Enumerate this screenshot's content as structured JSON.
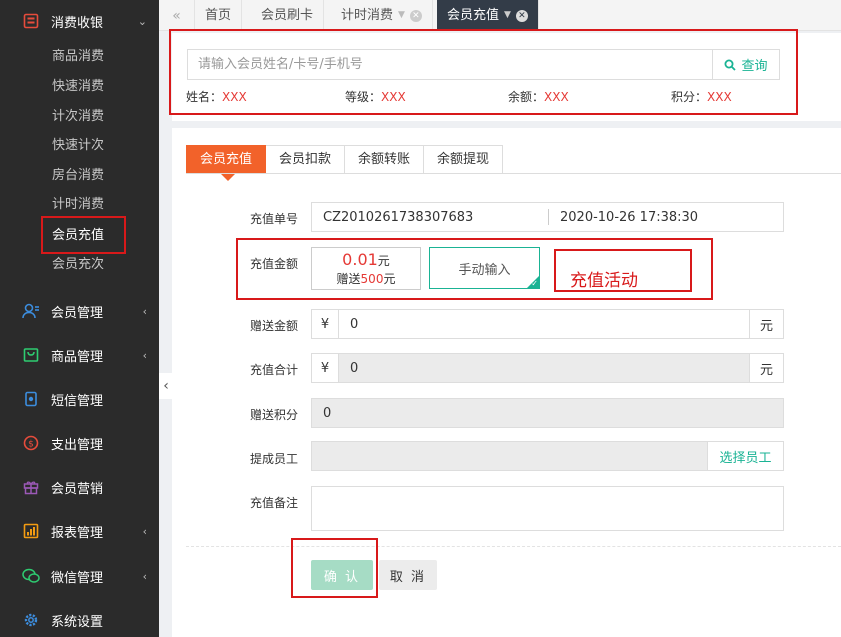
{
  "sidebar": {
    "groups": [
      {
        "label": "消费收银",
        "icon": "cashier-icon",
        "expanded": true
      },
      {
        "label": "会员管理",
        "icon": "member-icon"
      },
      {
        "label": "商品管理",
        "icon": "goods-icon"
      },
      {
        "label": "短信管理",
        "icon": "sms-icon"
      },
      {
        "label": "支出管理",
        "icon": "expense-icon"
      },
      {
        "label": "会员营销",
        "icon": "gift-icon"
      },
      {
        "label": "报表管理",
        "icon": "report-icon"
      },
      {
        "label": "微信管理",
        "icon": "wechat-icon"
      },
      {
        "label": "系统设置",
        "icon": "gear-icon"
      }
    ],
    "sub_items": [
      "商品消费",
      "快速消费",
      "计次消费",
      "快速计次",
      "房台消费",
      "计时消费",
      "会员充值",
      "会员充次"
    ],
    "active_sub": "会员充值"
  },
  "tabs": [
    {
      "label": "首页"
    },
    {
      "label": "会员刷卡"
    },
    {
      "label": "计时消费"
    },
    {
      "label": "会员充值",
      "active": true
    }
  ],
  "search": {
    "placeholder": "请输入会员姓名/卡号/手机号",
    "button": "查询",
    "info": [
      {
        "label": "姓名：",
        "value": "XXX"
      },
      {
        "label": "等级：",
        "value": "XXX"
      },
      {
        "label": "余额：",
        "value": "XXX"
      },
      {
        "label": "积分：",
        "value": "XXX"
      }
    ]
  },
  "subtabs": [
    "会员充值",
    "会员扣款",
    "余额转账",
    "余额提现"
  ],
  "form": {
    "order_no_label": "充值单号",
    "order_no": "CZ2010261738307683",
    "datetime": "2020-10-26 17:38:30",
    "amount_label": "充值金额",
    "amount_value": "0.01",
    "amount_unit": "元",
    "gift_prefix": "赠送",
    "gift_amount": "500",
    "gift_unit": "元",
    "manual_input": "手动输入",
    "promo_annotation": "充值活动",
    "gift_label": "赠送金额",
    "currency": "¥",
    "gift_value": "0",
    "unit": "元",
    "total_label": "充值合计",
    "total_value": "0",
    "points_label": "赠送积分",
    "points_value": "0",
    "staff_label": "提成员工",
    "select_staff": "选择员工",
    "remark_label": "充值备注",
    "confirm": "确 认",
    "cancel": "取 消"
  },
  "colors": {
    "accent": "#f2622a",
    "green": "#1ab394",
    "red": "#e53935",
    "annotation": "#d8191a",
    "sidebar_bg": "#2b2b2b"
  }
}
